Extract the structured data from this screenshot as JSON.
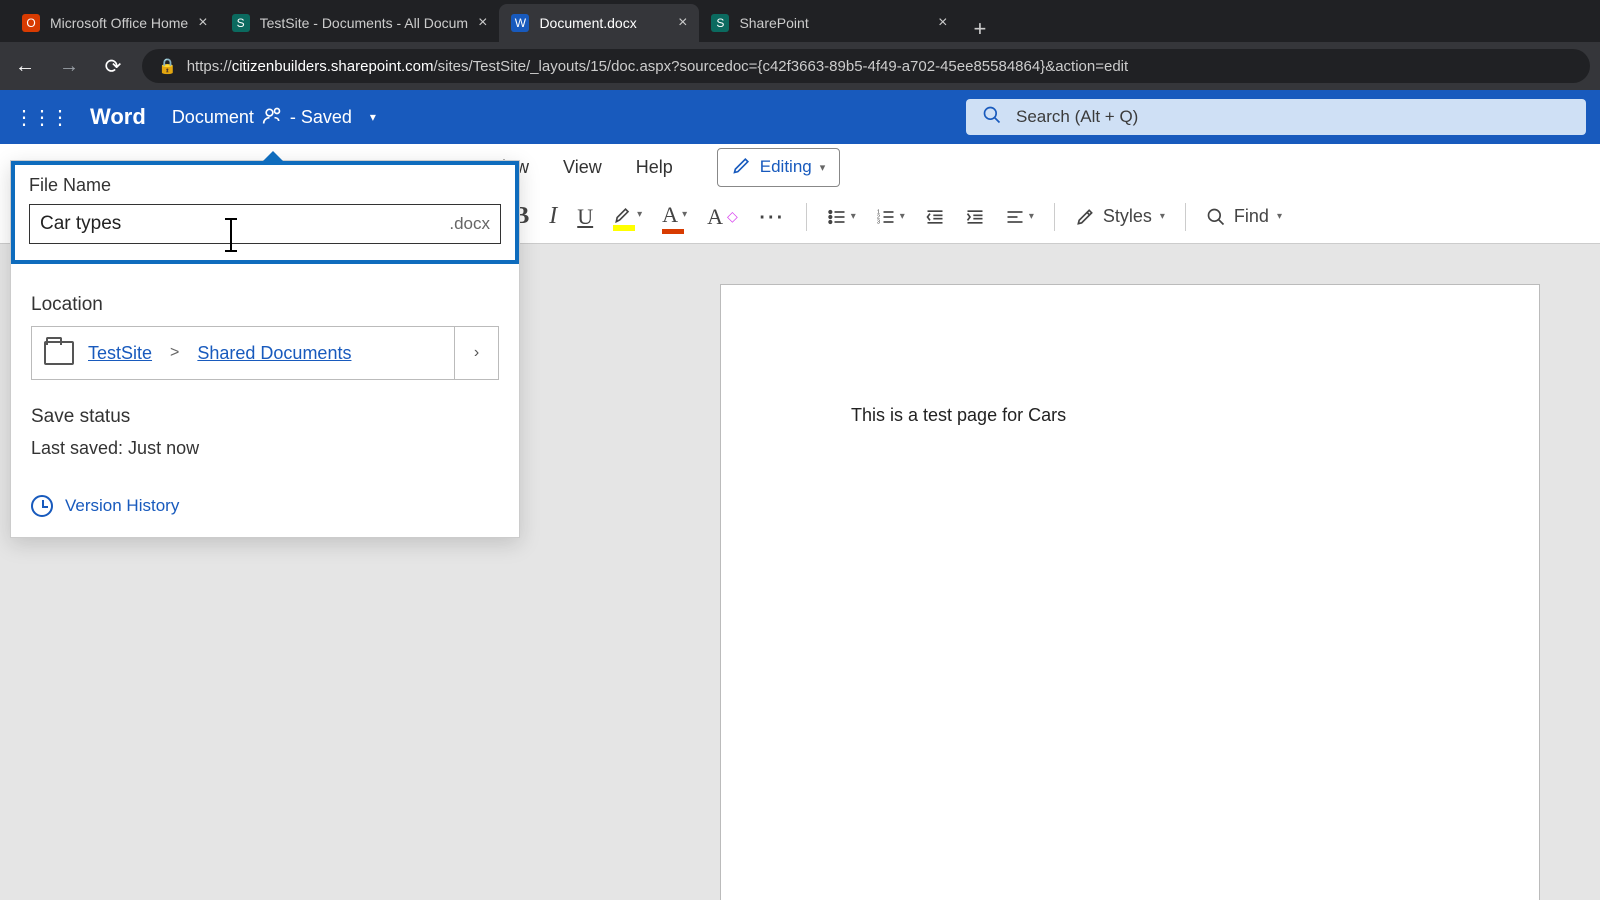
{
  "browser": {
    "tabs": [
      {
        "title": "Microsoft Office Home",
        "favicon_bg": "#d83b01",
        "favicon_text": "O",
        "active": false
      },
      {
        "title": "TestSite - Documents - All Docum",
        "favicon_bg": "#0b6a5f",
        "favicon_text": "S",
        "active": false
      },
      {
        "title": "Document.docx",
        "favicon_bg": "#185abd",
        "favicon_text": "W",
        "active": true
      },
      {
        "title": "SharePoint",
        "favicon_bg": "#0b6a5f",
        "favicon_text": "S",
        "active": false
      }
    ],
    "url_prefix": "https://",
    "url_host": "citizenbuilders.sharepoint.com",
    "url_path": "/sites/TestSite/_layouts/15/doc.aspx?sourcedoc={c42f3663-89b5-4f49-a702-45ee85584864}&action=edit"
  },
  "header": {
    "app_name": "Word",
    "doc_title": "Document",
    "saved_suffix": "- Saved",
    "search_placeholder": "Search (Alt + Q)"
  },
  "ribbon": {
    "tabs": {
      "review": "Review",
      "view": "View",
      "help": "Help"
    },
    "editing_label": "Editing",
    "styles_label": "Styles",
    "find_label": "Find",
    "more": "⋯"
  },
  "rename_panel": {
    "file_name_label": "File Name",
    "file_name_value": "Car types",
    "extension": ".docx",
    "location_label": "Location",
    "location_site": "TestSite",
    "location_sep": ">",
    "location_lib": "Shared Documents",
    "save_status_label": "Save status",
    "save_status_value": "Last saved: Just now",
    "version_history": "Version History"
  },
  "document": {
    "body_text": "This is a test page for Cars"
  }
}
